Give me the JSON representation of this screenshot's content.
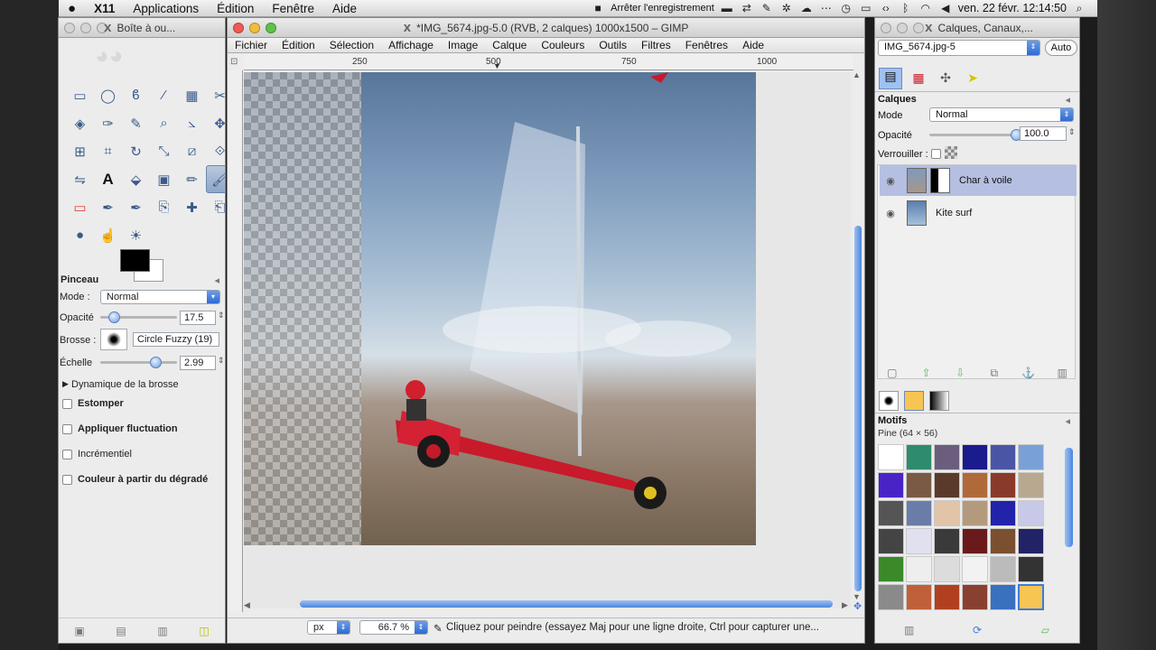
{
  "menubar": {
    "apple": "",
    "app": "X11",
    "items": [
      "Applications",
      "Édition",
      "Fenêtre",
      "Aide"
    ],
    "recording": "Arrêter l'enregistrement",
    "clock": "ven. 22 févr. 12:14:50"
  },
  "toolbox": {
    "title": "Boîte à ou...",
    "tool_options_title": "Pinceau",
    "mode_label": "Mode :",
    "mode_value": "Normal",
    "opacity_label": "Opacité",
    "opacity_value": "17.5",
    "opacity_fraction": 0.175,
    "brush_label": "Brosse :",
    "brush_value": "Circle Fuzzy (19)",
    "scale_label": "Échelle",
    "scale_value": "2.99",
    "dynamics_label": "Dynamique de la brosse",
    "checks": [
      {
        "label": "Estomper",
        "bold": true
      },
      {
        "label": "Appliquer fluctuation",
        "bold": true
      },
      {
        "label": "Incrémentiel",
        "bold": false
      },
      {
        "label": "Couleur à partir du dégradé",
        "bold": true
      }
    ],
    "tools": [
      "rect-select-icon",
      "ellipse-select-icon",
      "lasso-icon",
      "fuzzy-select-icon",
      "color-select-icon",
      "scissors-icon",
      "foreground-select-icon",
      "paths-icon",
      "color-picker-icon",
      "zoom-icon",
      "measure-icon",
      "move-icon",
      "align-icon",
      "crop-icon",
      "rotate-icon",
      "scale-icon",
      "shear-icon",
      "perspective-icon",
      "flip-icon",
      "text-icon",
      "bucket-fill-icon",
      "blend-icon",
      "pencil-icon",
      "paintbrush-icon",
      "eraser-icon",
      "airbrush-icon",
      "ink-icon",
      "clone-icon",
      "heal-icon",
      "perspective-clone-icon",
      "blur-icon",
      "smudge-icon",
      "dodge-icon"
    ]
  },
  "image_window": {
    "title": "*IMG_5674.jpg-5.0 (RVB, 2 calques) 1000x1500 – GIMP",
    "menu": [
      "Fichier",
      "Édition",
      "Sélection",
      "Affichage",
      "Image",
      "Calque",
      "Couleurs",
      "Outils",
      "Filtres",
      "Fenêtres",
      "Aide"
    ],
    "ruler_ticks": [
      "250",
      "500",
      "750",
      "1000"
    ],
    "unit": "px",
    "zoom": "66.7 %",
    "status": "Cliquez pour peindre (essayez Maj pour une ligne droite, Ctrl pour capturer une..."
  },
  "layers_dock": {
    "title": "Calques, Canaux,...",
    "image_select": "IMG_5674.jpg-5",
    "auto_button": "Auto",
    "panel_title": "Calques",
    "mode_label": "Mode",
    "mode_value": "Normal",
    "opacity_label": "Opacité",
    "opacity_value": "100.0",
    "lock_label": "Verrouiller :",
    "layers": [
      {
        "name": "Char à voile",
        "selected": true
      },
      {
        "name": "Kite surf",
        "selected": false
      }
    ],
    "patterns_title": "Motifs",
    "pattern_selected": "Pine (64 × 56)"
  },
  "colors": {
    "accent": "#3d7be0",
    "fg": "#000000",
    "bg": "#ffffff"
  }
}
